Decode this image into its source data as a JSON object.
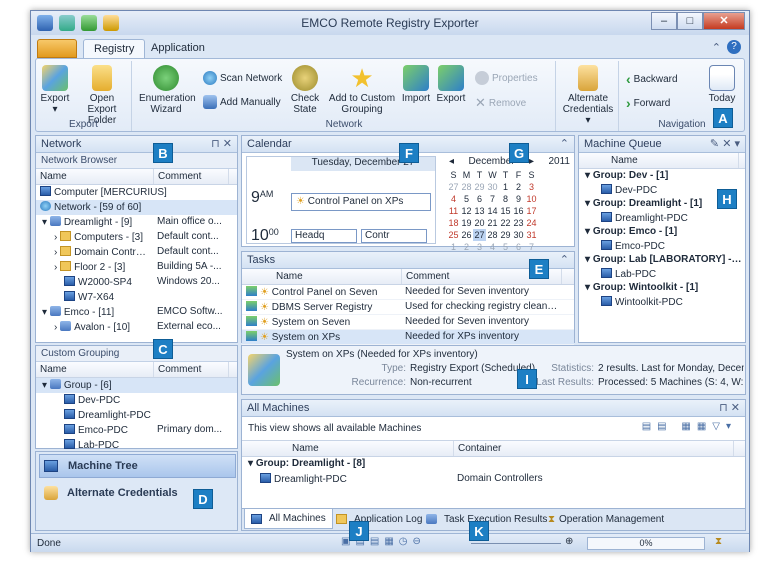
{
  "window": {
    "title": "EMCO Remote Registry Exporter"
  },
  "tabs": {
    "registry": "Registry",
    "application": "Application"
  },
  "ribbon": {
    "export_group": {
      "label": "Export",
      "export": "Export",
      "open_export_folder": "Open Export Folder"
    },
    "network_group": {
      "label": "Network",
      "enumeration_wizard": "Enumeration Wizard",
      "scan_network": "Scan Network",
      "add_manually": "Add Manually",
      "check_state": "Check State",
      "add_to_custom_grouping": "Add to Custom Grouping",
      "import": "Import",
      "export": "Export",
      "properties": "Properties",
      "remove": "Remove",
      "alternate_credentials": "Alternate Credentials"
    },
    "navigation_group": {
      "label": "Navigation",
      "backward": "Backward",
      "forward": "Forward",
      "today": "Today"
    }
  },
  "network_panel": {
    "title": "Network",
    "browser_title": "Network Browser",
    "col_name": "Name",
    "col_comment": "Comment",
    "rows": [
      {
        "name": "Computer [MERCURIUS]",
        "comment": ""
      },
      {
        "name": "Network - [59 of 60]",
        "comment": ""
      },
      {
        "name": "Dreamlight - [9]",
        "comment": "Main office o..."
      },
      {
        "name": "Computers - [3]",
        "comment": "Default cont..."
      },
      {
        "name": "Domain Controll...",
        "comment": "Default cont..."
      },
      {
        "name": "Floor 2 - [3]",
        "comment": "Building 5A -..."
      },
      {
        "name": "W2000-SP4",
        "comment": "Windows 20..."
      },
      {
        "name": "W7-X64",
        "comment": ""
      },
      {
        "name": "Emco - [11]",
        "comment": "EMCO Softw..."
      },
      {
        "name": "Avalon - [10]",
        "comment": "External eco..."
      }
    ]
  },
  "custom_grouping": {
    "title": "Custom Grouping",
    "col_name": "Name",
    "col_comment": "Comment",
    "rows": [
      {
        "name": "Group - [6]",
        "comment": ""
      },
      {
        "name": "Dev-PDC",
        "comment": ""
      },
      {
        "name": "Dreamlight-PDC",
        "comment": ""
      },
      {
        "name": "Emco-PDC",
        "comment": "Primary dom..."
      },
      {
        "name": "Lab-PDC",
        "comment": ""
      }
    ]
  },
  "nav_buttons": {
    "machine_tree": "Machine Tree",
    "alternate_credentials": "Alternate Credentials"
  },
  "calendar": {
    "title": "Calendar",
    "day_header": "Tuesday, December 27",
    "time_9": "9",
    "time_9_suffix": "AM",
    "time_10": "10",
    "time_10_suffix": "00",
    "event_main": "Control Panel on XPs",
    "event_a": "Headq",
    "event_b": "Contr"
  },
  "mini_calendar": {
    "month": "December",
    "year": "2011",
    "weekdays": [
      "S",
      "M",
      "T",
      "W",
      "T",
      "F",
      "S"
    ],
    "weeks": [
      [
        "27",
        "28",
        "29",
        "30",
        "1",
        "2",
        "3"
      ],
      [
        "4",
        "5",
        "6",
        "7",
        "8",
        "9",
        "10"
      ],
      [
        "11",
        "12",
        "13",
        "14",
        "15",
        "16",
        "17"
      ],
      [
        "18",
        "19",
        "20",
        "21",
        "22",
        "23",
        "24"
      ],
      [
        "25",
        "26",
        "27",
        "28",
        "29",
        "30",
        "31"
      ],
      [
        "1",
        "2",
        "3",
        "4",
        "5",
        "6",
        "7"
      ]
    ]
  },
  "tasks": {
    "title": "Tasks",
    "col_name": "Name",
    "col_comment": "Comment",
    "rows": [
      {
        "name": "Control Panel on Seven",
        "comment": "Needed for Seven inventory"
      },
      {
        "name": "DBMS Server Registry",
        "comment": "Used for checking registry cleanness on"
      },
      {
        "name": "System on Seven",
        "comment": "Needed for Seven inventory"
      },
      {
        "name": "System on XPs",
        "comment": "Needed for XPs inventory"
      }
    ]
  },
  "machine_queue": {
    "title": "Machine Queue",
    "col_name": "Name",
    "rows": [
      {
        "name": "Group: Dev - [1]",
        "group": true
      },
      {
        "name": "Dev-PDC",
        "group": false
      },
      {
        "name": "Group: Dreamlight - [1]",
        "group": true
      },
      {
        "name": "Dreamlight-PDC",
        "group": false
      },
      {
        "name": "Group: Emco - [1]",
        "group": true
      },
      {
        "name": "Emco-PDC",
        "group": false
      },
      {
        "name": "Group: Lab [LABORATORY] - [1]",
        "group": true
      },
      {
        "name": "Lab-PDC",
        "group": false
      },
      {
        "name": "Group: Wintoolkit - [1]",
        "group": true
      },
      {
        "name": "Wintoolkit-PDC",
        "group": false
      }
    ]
  },
  "info": {
    "task_title": "System on XPs (Needed for XPs inventory)",
    "type_label": "Type:",
    "type_value": "Registry Export (Scheduled)",
    "recurrence_label": "Recurrence:",
    "recurrence_value": "Non-recurrent",
    "statistics_label": "Statistics:",
    "statistics_value": "2 results. Last for Monday, December ...",
    "last_results_label": "Last Results:",
    "last_results_value": "Processed: 5 Machines (S: 4, W: 0, E: ..."
  },
  "all_machines": {
    "title": "All Machines",
    "subtitle": "This view shows all available Machines",
    "col_name": "Name",
    "col_container": "Container",
    "group_row": "Group: Dreamlight - [8]",
    "row_name": "Dreamlight-PDC",
    "row_container": "Domain Controllers"
  },
  "bottom_tabs": [
    "All Machines",
    "Application Log",
    "Task Execution Results",
    "Operation Management"
  ],
  "status": {
    "text": "Done",
    "progress": "0%"
  },
  "callouts": [
    "A",
    "B",
    "C",
    "D",
    "E",
    "F",
    "G",
    "H",
    "I",
    "J",
    "K"
  ]
}
